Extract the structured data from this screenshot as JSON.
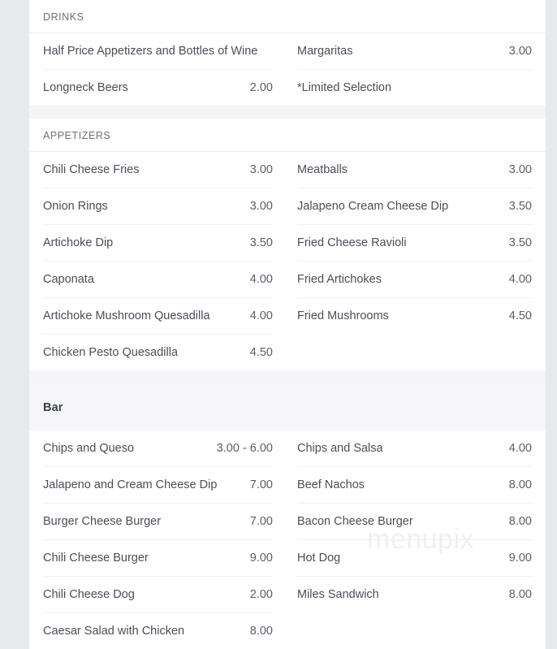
{
  "watermark": {
    "text": "menupix"
  },
  "colors": {
    "page_background": "#e8e9ed",
    "card_background": "#ffffff",
    "section_band": "#f5f5f8",
    "emphasis_header_background": "#f6f6f9",
    "row_rule": "#f0f0f3",
    "item_text": "#4a4e58",
    "price_text": "#5a5e68",
    "section_header_text": "#6c6f7a",
    "watermark_text": "#f0f0f2"
  },
  "sections": [
    {
      "title": "DRINKS",
      "style": "uppercase",
      "columns": [
        {
          "items": [
            {
              "name": "Half Price Appetizers and Bottles of Wine",
              "price": ""
            },
            {
              "name": "Longneck Beers",
              "price": "2.00"
            }
          ]
        },
        {
          "items": [
            {
              "name": "Margaritas",
              "price": "3.00"
            },
            {
              "name": "*Limited Selection",
              "price": ""
            }
          ]
        }
      ]
    },
    {
      "title": "APPETIZERS",
      "style": "uppercase",
      "columns": [
        {
          "items": [
            {
              "name": "Chili Cheese Fries",
              "price": "3.00"
            },
            {
              "name": "Onion Rings",
              "price": "3.00"
            },
            {
              "name": "Artichoke Dip",
              "price": "3.50"
            },
            {
              "name": "Caponata",
              "price": "4.00"
            },
            {
              "name": "Artichoke Mushroom Quesadilla",
              "price": "4.00"
            },
            {
              "name": "Chicken Pesto Quesadilla",
              "price": "4.50"
            }
          ]
        },
        {
          "items": [
            {
              "name": "Meatballs",
              "price": "3.00"
            },
            {
              "name": "Jalapeno Cream Cheese Dip",
              "price": "3.50"
            },
            {
              "name": "Fried Cheese Ravioli",
              "price": "3.50"
            },
            {
              "name": "Fried Artichokes",
              "price": "4.00"
            },
            {
              "name": "Fried Mushrooms",
              "price": "4.50"
            }
          ]
        }
      ]
    },
    {
      "title": "Bar",
      "style": "emphasis",
      "columns": [
        {
          "items": [
            {
              "name": "Chips and Queso",
              "price": "3.00 - 6.00"
            },
            {
              "name": "Jalapeno and Cream Cheese Dip",
              "price": "7.00"
            },
            {
              "name": "Burger Cheese Burger",
              "price": "7.00"
            },
            {
              "name": "Chili Cheese Burger",
              "price": "9.00"
            },
            {
              "name": "Chili Cheese Dog",
              "price": "2.00"
            },
            {
              "name": "Caesar Salad with Chicken",
              "price": "8.00"
            }
          ]
        },
        {
          "items": [
            {
              "name": "Chips and Salsa",
              "price": "4.00"
            },
            {
              "name": "Beef Nachos",
              "price": "8.00"
            },
            {
              "name": "Bacon Cheese Burger",
              "price": "8.00"
            },
            {
              "name": "Hot Dog",
              "price": "9.00"
            },
            {
              "name": "Miles Sandwich",
              "price": "8.00"
            }
          ]
        }
      ]
    }
  ]
}
